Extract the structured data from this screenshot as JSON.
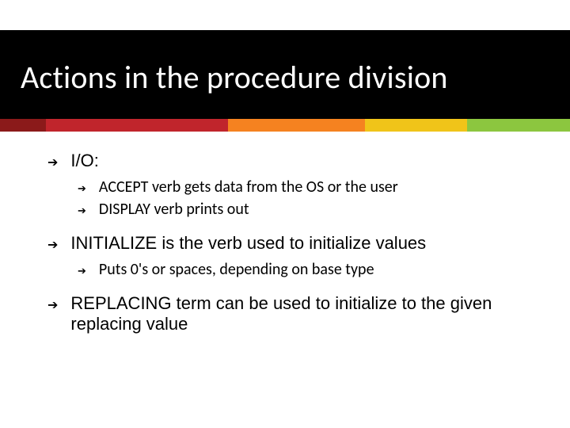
{
  "title": "Actions in the procedure division",
  "bullets": [
    {
      "text": "I/O:",
      "children": [
        "ACCEPT verb gets data from the OS or the user",
        "DISPLAY verb prints out"
      ]
    },
    {
      "text": "INITIALIZE is the verb used to initialize values",
      "children": [
        "Puts 0's or spaces, depending on base type"
      ]
    },
    {
      "text": "REPLACING term can be used to initialize to the given replacing value",
      "children": []
    }
  ],
  "colors": {
    "band": "#000000",
    "stripe": [
      "#8b1a1a",
      "#c0252c",
      "#f58220",
      "#f0c419",
      "#8cc63f"
    ]
  }
}
